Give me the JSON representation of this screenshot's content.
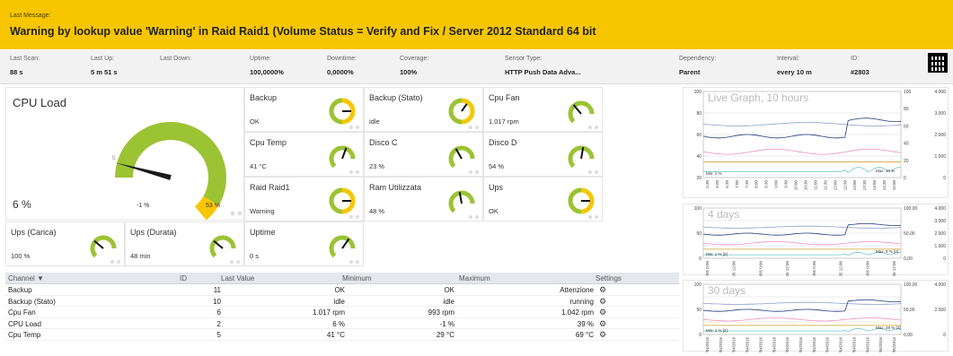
{
  "banner": {
    "label": "Last Message:",
    "message": "Warning by lookup value 'Warning' in Raid Raid1 (Volume Status = Verify and Fix / Server 2012 Standard 64 bit",
    "color": "#f7c600"
  },
  "info": [
    {
      "k": "Last Scan:",
      "v": "88 s"
    },
    {
      "k": "Last Up:",
      "v": "5 m 51 s"
    },
    {
      "k": "Last Down:",
      "v": ""
    },
    {
      "k": "Uptime:",
      "v": "100,0000%"
    },
    {
      "k": "Downtime:",
      "v": "0,0000%"
    },
    {
      "k": "Coverage:",
      "v": "100%"
    },
    {
      "k": "Sensor Type:",
      "v": "HTTP Push Data Adva..."
    },
    {
      "k": "Dependency:",
      "v": "Parent"
    },
    {
      "k": "Interval:",
      "v": "every 10 m"
    },
    {
      "k": "ID:",
      "v": "#2803"
    }
  ],
  "cpu": {
    "title": "CPU Load",
    "value": "6 %",
    "min": "-1 %",
    "max": "53 %",
    "level": 0.06
  },
  "gauges": [
    {
      "title": "Backup",
      "value": "OK",
      "type": "ring"
    },
    {
      "title": "Backup (Stato)",
      "value": "idle",
      "type": "ring"
    },
    {
      "title": "Cpu Fan",
      "value": "1.017 rpm",
      "type": "arc",
      "needle": -40
    },
    {
      "title": "Cpu Temp",
      "value": "41 °C",
      "type": "arc",
      "needle": 20
    },
    {
      "title": "Disco C",
      "value": "23 %",
      "type": "arc",
      "needle": -30
    },
    {
      "title": "Disco D",
      "value": "54 %",
      "type": "arc",
      "needle": 10
    },
    {
      "title": "Raid Raid1",
      "value": "Warning",
      "type": "ring"
    },
    {
      "title": "Ram Utilizzata",
      "value": "48 %",
      "type": "arc",
      "needle": -10
    },
    {
      "title": "Ups",
      "value": "OK",
      "type": "ring"
    },
    {
      "title": "Ups (Carica)",
      "value": "100 %",
      "type": "arc",
      "needle": -50
    },
    {
      "title": "Ups (Durata)",
      "value": "48 min",
      "type": "arc",
      "needle": -50
    },
    {
      "title": "Uptime",
      "value": "0 s",
      "type": "arc",
      "needle": 35
    }
  ],
  "table": {
    "headers": {
      "channel": "Channel ▼",
      "id": "ID",
      "last": "Last Value",
      "min": "Minimum",
      "max": "Maximum",
      "settings": "Settings"
    },
    "rows": [
      {
        "channel": "Backup",
        "id": "11",
        "last": "OK",
        "min": "OK",
        "max": "Attenzione"
      },
      {
        "channel": "Backup (Stato)",
        "id": "10",
        "last": "idle",
        "min": "idle",
        "max": "running"
      },
      {
        "channel": "Cpu Fan",
        "id": "6",
        "last": "1.017 rpm",
        "min": "993 rpm",
        "max": "1.042 rpm"
      },
      {
        "channel": "CPU Load",
        "id": "2",
        "last": "6 %",
        "min": "-1 %",
        "max": "39 %"
      },
      {
        "channel": "Cpu Temp",
        "id": "5",
        "last": "41 °C",
        "min": "29 °C",
        "max": "69 °C"
      }
    ]
  },
  "graphs": [
    {
      "title": "Live Graph, 10 hours",
      "y_left": [
        "100",
        "80",
        "60",
        "40",
        "20"
      ],
      "y_right1": [
        "100",
        "80",
        "60",
        "40",
        "20",
        "0"
      ],
      "y_right2": [
        "4.000",
        "3.000",
        "2.000",
        "1.000",
        "0"
      ],
      "min_label": "Min: 1 %",
      "max_label": "Max: 10 %",
      "x_ticks": [
        "5:30",
        "6:00",
        "6:30",
        "7:00",
        "7:30",
        "8:00",
        "8:30",
        "9:00",
        "9:30",
        "10:00",
        "10:30",
        "11:00",
        "11:30",
        "12:00",
        "12:30",
        "13:00",
        "13:30",
        "14:00",
        "14:30",
        "15:00"
      ]
    },
    {
      "title": "4 days",
      "y_left": [
        "100",
        "50",
        "0"
      ],
      "y_right1": [
        "100,00",
        "50,00",
        "0,00"
      ],
      "y_right2": [
        "4.000",
        "3.000",
        "2.000",
        "1.000",
        "0"
      ],
      "min_label": "Min: 1 % [2]",
      "max_label": "Max: 8 % [2]",
      "x_ticks": [
        "02/05 0:00",
        "02/05 12:00",
        "03/05 0:00",
        "03/05 12:00",
        "04/05 0:00",
        "04/05 12:00",
        "05/05 0:00",
        "05/05 12:00"
      ]
    },
    {
      "title": "30 days",
      "y_left": [
        "100",
        "50",
        "0"
      ],
      "y_right1": [
        "100,00",
        "50,00",
        "0,00"
      ],
      "y_right2": [
        "4.000",
        "2.000",
        "0"
      ],
      "min_label": "Min: 1 % [2]",
      "max_label": "Max: 28 % [2]",
      "x_ticks": [
        "06/04/2016",
        "08/04/2016",
        "10/04/2016",
        "12/04/2016",
        "14/04/2016",
        "16/04/2016",
        "18/04/2016",
        "20/04/2016",
        "22/04/2016",
        "24/04/2016",
        "26/04/2016",
        "28/04/2016",
        "30/04/2016",
        "02/05/2016",
        "04/05/2016"
      ]
    }
  ]
}
